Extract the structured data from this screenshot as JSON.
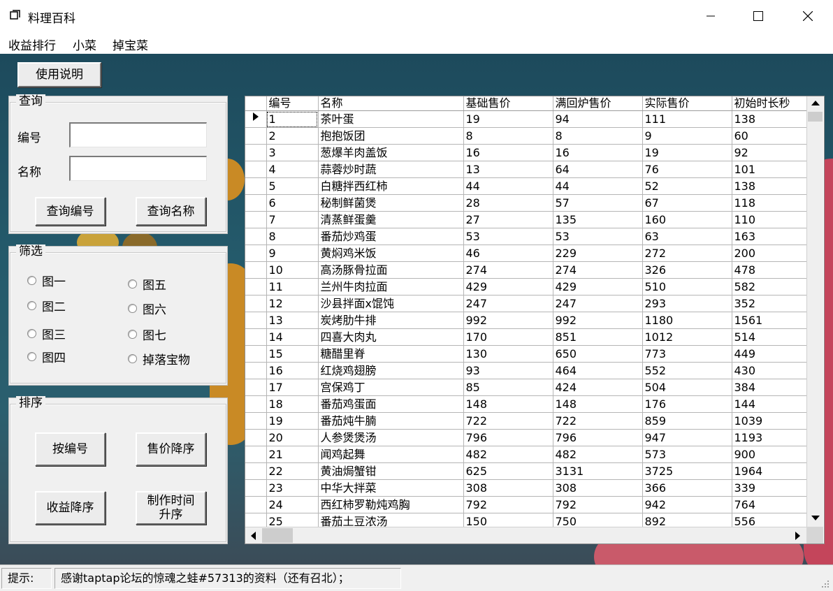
{
  "window": {
    "title": "料理百科"
  },
  "menu": {
    "items": [
      "收益排行",
      "小菜",
      "掉宝菜"
    ]
  },
  "toolbar": {
    "help_label": "使用说明"
  },
  "query": {
    "legend": "查询",
    "id_label": "编号",
    "name_label": "名称",
    "id_value": "",
    "name_value": "",
    "query_id_button": "查询编号",
    "query_name_button": "查询名称"
  },
  "filter": {
    "legend": "筛选",
    "options": [
      "图一",
      "图五",
      "图二",
      "图六",
      "图三",
      "图七",
      "图四",
      "掉落宝物"
    ]
  },
  "sort": {
    "legend": "排序",
    "by_id": "按编号",
    "price_desc": "售价降序",
    "profit_desc": "收益降序",
    "time_asc": "制作时间\n升序"
  },
  "table": {
    "columns": [
      "编号",
      "名称",
      "基础售价",
      "满回炉售价",
      "实际售价",
      "初始时长秒"
    ],
    "rows": [
      [
        "1",
        "茶叶蛋",
        "19",
        "94",
        "111",
        "138"
      ],
      [
        "2",
        "抱抱饭团",
        "8",
        "8",
        "9",
        "60"
      ],
      [
        "3",
        "葱爆羊肉盖饭",
        "16",
        "16",
        "19",
        "92"
      ],
      [
        "4",
        "蒜蓉炒时蔬",
        "13",
        "64",
        "76",
        "101"
      ],
      [
        "5",
        "白糖拌西红柿",
        "44",
        "44",
        "52",
        "138"
      ],
      [
        "6",
        "秘制鲜菌煲",
        "28",
        "57",
        "67",
        "118"
      ],
      [
        "7",
        "清蒸鲜蛋羹",
        "27",
        "135",
        "160",
        "110"
      ],
      [
        "8",
        "番茄炒鸡蛋",
        "53",
        "53",
        "63",
        "163"
      ],
      [
        "9",
        "黄焖鸡米饭",
        "46",
        "229",
        "272",
        "200"
      ],
      [
        "10",
        "高汤豚骨拉面",
        "274",
        "274",
        "326",
        "478"
      ],
      [
        "11",
        "兰州牛肉拉面",
        "429",
        "429",
        "510",
        "582"
      ],
      [
        "12",
        "沙县拌面x馄饨",
        "247",
        "247",
        "293",
        "352"
      ],
      [
        "13",
        "炭烤肋牛排",
        "992",
        "992",
        "1180",
        "1561"
      ],
      [
        "14",
        "四喜大肉丸",
        "170",
        "851",
        "1012",
        "514"
      ],
      [
        "15",
        "糖醋里脊",
        "130",
        "650",
        "773",
        "449"
      ],
      [
        "16",
        "红烧鸡翅膀",
        "93",
        "464",
        "552",
        "430"
      ],
      [
        "17",
        "宫保鸡丁",
        "85",
        "424",
        "504",
        "384"
      ],
      [
        "18",
        "番茄鸡蛋面",
        "148",
        "148",
        "176",
        "144"
      ],
      [
        "19",
        "番茄炖牛腩",
        "722",
        "722",
        "859",
        "1039"
      ],
      [
        "20",
        "人参煲煲汤",
        "796",
        "796",
        "947",
        "1193"
      ],
      [
        "21",
        "闻鸡起舞",
        "482",
        "482",
        "573",
        "900"
      ],
      [
        "22",
        "黄油焗蟹钳",
        "625",
        "3131",
        "3725",
        "1964"
      ],
      [
        "23",
        "中华大拌菜",
        "308",
        "308",
        "366",
        "339"
      ],
      [
        "24",
        "西红柿罗勒炖鸡胸",
        "792",
        "792",
        "942",
        "764"
      ],
      [
        "25",
        "番茄土豆浓汤",
        "150",
        "750",
        "892",
        "556"
      ]
    ]
  },
  "status": {
    "label": "提示:",
    "message": "感谢taptap论坛的惊魂之蛙#57313的资料（还有召北）；"
  },
  "colors": {
    "background": "#245a6b",
    "panel": "#f0f0f0"
  }
}
